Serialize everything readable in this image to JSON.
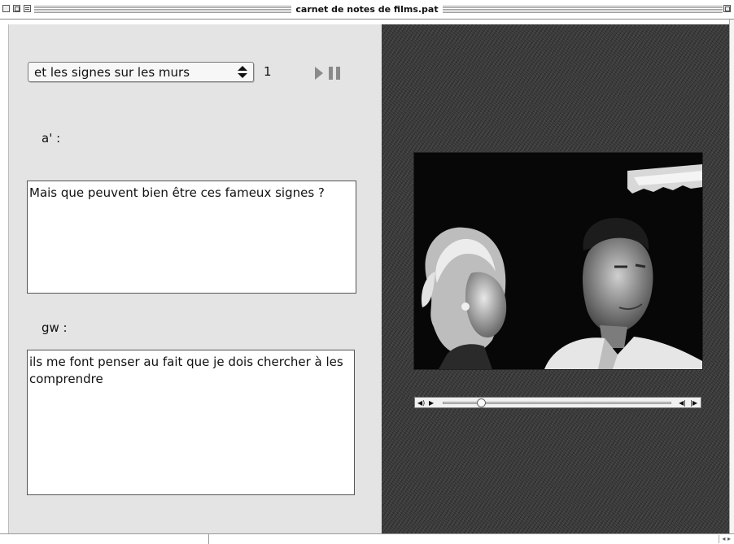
{
  "window": {
    "title": "carnet de notes de films.pat"
  },
  "toolbar": {
    "sequence_select": "et les signes sur les murs",
    "counter": "1"
  },
  "notes": [
    {
      "speaker": "a' :",
      "text": "Mais que peuvent bien être ces fameux signes ?"
    },
    {
      "speaker": "gw :",
      "text": "ils me font penser au fait que je dois chercher à les comprendre"
    }
  ],
  "player": {
    "progress_fraction": 0.17
  }
}
